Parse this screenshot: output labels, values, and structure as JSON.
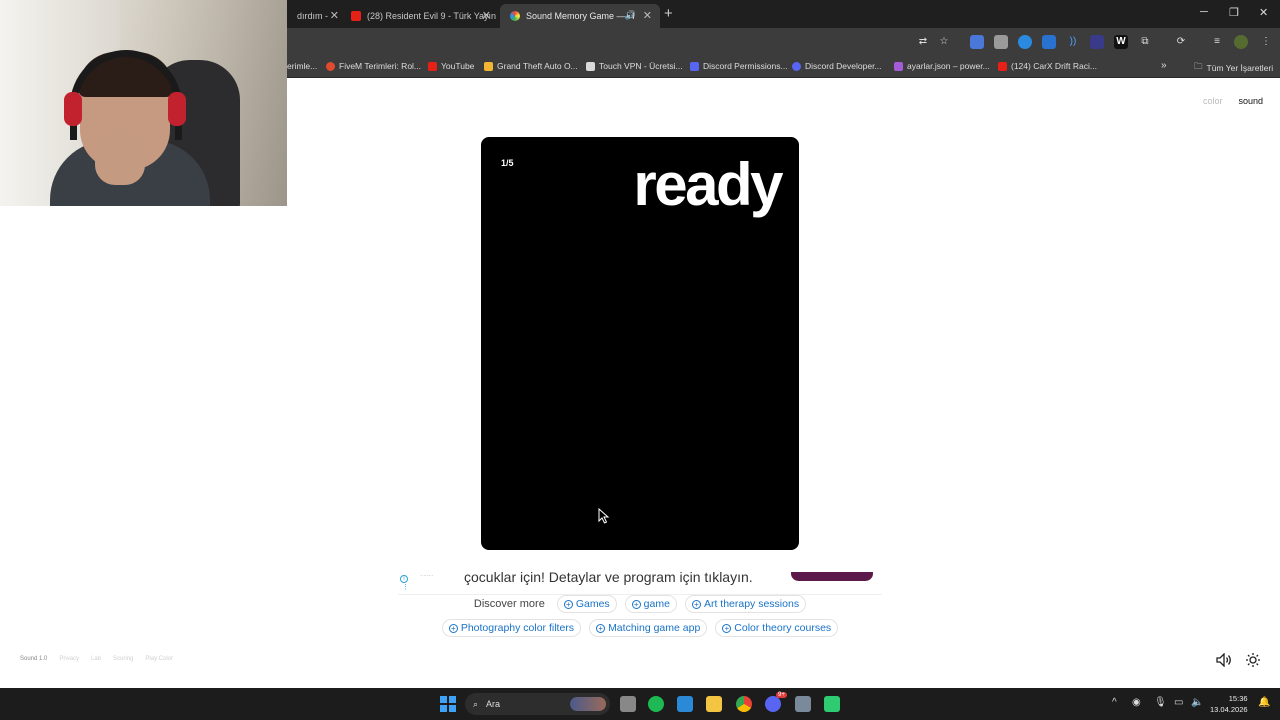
{
  "browser": {
    "tabs": [
      {
        "title": "dırdım -",
        "favicon": "generic-icon",
        "active": false
      },
      {
        "title": "(28) Resident Evil 9 - Türk Yayın",
        "favicon": "youtube-icon",
        "active": false
      },
      {
        "title": "Sound Memory Game — H",
        "favicon": "color-wheel-icon",
        "active": true,
        "audio": true
      }
    ],
    "new_tab_symbol": "+",
    "window_controls": [
      "─",
      "❐",
      "✕"
    ],
    "bookmarks": [
      {
        "label": "erimle...",
        "icon": "generic-icon",
        "color": "#888888"
      },
      {
        "label": "FiveM Terimleri: Rol...",
        "icon": "fivem-icon",
        "color": "#e04a2f"
      },
      {
        "label": "YouTube",
        "icon": "youtube-icon",
        "color": "#e62117"
      },
      {
        "label": "Grand Theft Auto O...",
        "icon": "gta-icon",
        "color": "#f2b632"
      },
      {
        "label": "Touch VPN - Ücretsi...",
        "icon": "vpn-icon",
        "color": "#d9d9d9"
      },
      {
        "label": "Discord Permissions...",
        "icon": "discord-icon",
        "color": "#5865f2"
      },
      {
        "label": "Discord Developer...",
        "icon": "discord-icon",
        "color": "#5865f2"
      },
      {
        "label": "ayarlar.json – power...",
        "icon": "json-icon",
        "color": "#a35bd6"
      },
      {
        "label": "(124) CarX Drift Raci...",
        "icon": "youtube-icon",
        "color": "#e62117"
      }
    ],
    "bookmarks_more": "»",
    "bookmarks_folder": "Tüm Yer İşaretleri"
  },
  "page": {
    "mode_options": [
      {
        "label": "color",
        "active": false
      },
      {
        "label": "sound",
        "active": true
      }
    ],
    "card": {
      "round_counter": "1/5",
      "status_word": "ready"
    },
    "ad": {
      "mini_label": "········",
      "text": "çocuklar için! Detaylar ve program için tıklayın."
    },
    "discover": {
      "label": "Discover more",
      "row1": [
        "Games",
        "game",
        "Art therapy sessions"
      ],
      "row2": [
        "Photography color filters",
        "Matching game app",
        "Color theory courses"
      ]
    },
    "footer_links": [
      "Sound 1.0",
      "Privacy",
      "Lab",
      "Scoring",
      "Play Color"
    ]
  },
  "taskbar": {
    "search_placeholder": "Ara",
    "time": "15:36",
    "date": "13.04.2026",
    "discord_badge": "9+"
  }
}
